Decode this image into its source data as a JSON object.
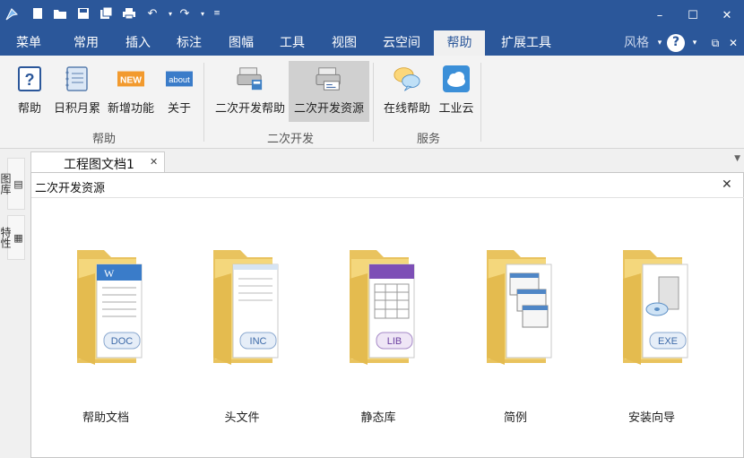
{
  "titlebar": {
    "window_buttons": {
      "minimize": "–",
      "maximize": "☐",
      "close": "✕"
    }
  },
  "menubar": {
    "tabs": [
      {
        "label": "菜单"
      },
      {
        "label": "常用"
      },
      {
        "label": "插入"
      },
      {
        "label": "标注"
      },
      {
        "label": "图幅"
      },
      {
        "label": "工具"
      },
      {
        "label": "视图"
      },
      {
        "label": "云空间"
      },
      {
        "label": "帮助"
      },
      {
        "label": "扩展工具"
      }
    ],
    "active_tab": "帮助",
    "style_label": "风格",
    "style_arrow": "▾",
    "help_glyph": "?",
    "restore": "⧉",
    "close": "✕"
  },
  "ribbon": {
    "buttons": {
      "help": {
        "label": "帮助",
        "icon": "question-icon"
      },
      "daily": {
        "label": "日积月累",
        "icon": "notebook-icon"
      },
      "new_feature": {
        "label": "新增功能",
        "icon_text": "NEW"
      },
      "about": {
        "label": "关于",
        "icon_text": "about"
      },
      "dev_help": {
        "label": "二次开发帮助",
        "icon": "printer-help-icon"
      },
      "dev_resources": {
        "label": "二次开发资源",
        "icon": "printer-resource-icon"
      },
      "online_help": {
        "label": "在线帮助",
        "icon": "chat-bubbles-icon"
      },
      "industry_cloud": {
        "label": "工业云",
        "icon": "cloud-icon"
      }
    },
    "groups": {
      "help": "帮助",
      "dev": "二次开发",
      "service": "服务"
    },
    "selected": "二次开发资源"
  },
  "side": {
    "library": "图库",
    "properties": "特性"
  },
  "doc_tab": {
    "label": "工程图文档1",
    "close": "✕"
  },
  "tabbar_dropdown": "▼",
  "panel": {
    "title": "二次开发资源",
    "close": "✕",
    "items": [
      {
        "label": "帮助文档",
        "badge": "DOC"
      },
      {
        "label": "头文件",
        "badge": "INC"
      },
      {
        "label": "静态库",
        "badge": "LIB"
      },
      {
        "label": "简例",
        "badge": ""
      },
      {
        "label": "安装向导",
        "badge": "EXE"
      }
    ]
  },
  "colors": {
    "titlebar": "#2b579a",
    "active_tab_bg": "#f0f0f0",
    "selected_button": "#d0d0d0",
    "folder": "#f4d77c"
  }
}
